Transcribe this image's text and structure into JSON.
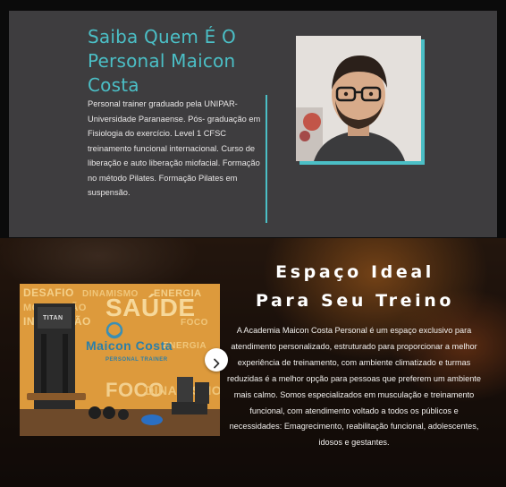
{
  "about": {
    "title": "Saiba Quem É O Personal Maicon Costa",
    "bio": "Personal trainer graduado pela UNIPAR- Universidade Paranaense. Pós- graduação em Fisiologia do exercício. Level 1 CFSC treinamento funcional internacional. Curso de liberação e auto liberação miofacial. Formação no método Pilates. Formação Pilates em suspensão."
  },
  "gym": {
    "title_line1": "Espaço Ideal",
    "title_line2": "Para Seu Treino",
    "description": "A Academia Maicon Costa Personal é um espaço exclusivo para atendimento personalizado, estruturado para proporcionar a melhor experiência de treinamento, com ambiente climatizado e turmas reduzidas é a melhor opção para pessoas que preferem um ambiente mais calmo. Somos especializados em musculação e treinamento funcional, com atendimento voltado a todos os públicos e necessidades: Emagrecimento, reabilitação funcional, adolescentes, idosos e gestantes."
  },
  "carousel": {
    "logo_text": "Maicon Costa",
    "logo_subtext": "PERSONAL TRAINER",
    "machine_label": "TITAN",
    "wall_words": [
      "SAÚDE",
      "DESAFIO",
      "DINAMISMO",
      "ENERGIA",
      "MOTIVAÇÃO",
      "INTERAÇÃO",
      "FOCO"
    ],
    "next_icon": "chevron-right-icon"
  },
  "colors": {
    "accent": "#4bbfc6",
    "card_bg": "#3e3d3f",
    "wall_orange": "#e09b3a"
  }
}
